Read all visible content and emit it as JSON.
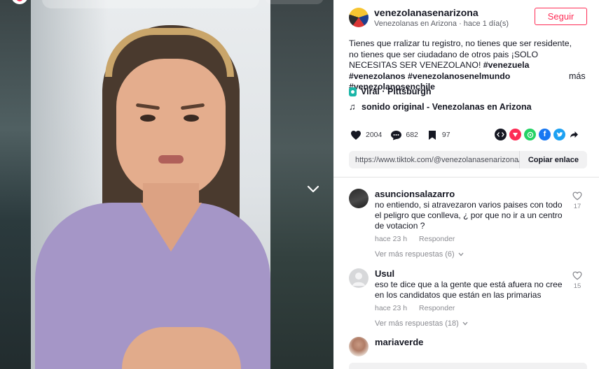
{
  "video": {
    "next_label": "next-video"
  },
  "author": {
    "username": "venezolanasenarizona",
    "meta": "Venezolanas  en  Arizona · hace 1 día(s)",
    "follow_label": "Seguir"
  },
  "description": {
    "text": "Tienes que rralizar tu registro, no tienes que ser residente, no tienes que ser ciudadano de otros pais ¡SOLO NECESITAS SER VENEZOLANO!",
    "hashtags": "#venezuela #venezolanos #venezolanosenelmundo #venezolanosenchile",
    "more_label": "más"
  },
  "anchor": {
    "label": "Viral · Pittsburgh",
    "icon": "location-pin-icon",
    "color": "#1bb6a8"
  },
  "music": {
    "label": "sonido original - Venezolanas  en  Arizona",
    "icon": "music-note-icon"
  },
  "stats": {
    "likes": "2004",
    "comments": "682",
    "saves": "97"
  },
  "share": {
    "icons": [
      "embed-icon",
      "repost-icon",
      "whatsapp-icon",
      "facebook-icon",
      "twitter-icon",
      "share-arrow-icon"
    ],
    "colors": {
      "embed": "#161823",
      "repost": "#fe2c55",
      "whatsapp": "#25d366",
      "facebook": "#1877f2",
      "twitter": "#1da1f2"
    }
  },
  "link": {
    "url": "https://www.tiktok.com/@venezolanasenarizona/...",
    "copy_label": "Copiar enlace"
  },
  "comments": [
    {
      "username": "asuncionsalazarro",
      "text": "no entiendo, si atravezaron varios paises con todo el peligro que conlleva, ¿ por que no ir a un centro de votacion ?",
      "time": "hace 23 h",
      "reply_label": "Responder",
      "likes": "17",
      "more_replies": "Ver más respuestas (6)"
    },
    {
      "username": "Usul",
      "text": "eso te dice que a la gente que está afuera no cree en los candidatos que están en las primarias",
      "time": "hace 23 h",
      "reply_label": "Responder",
      "likes": "15",
      "more_replies": "Ver más respuestas (18)"
    },
    {
      "username": "mariaverde"
    }
  ],
  "colors": {
    "accent": "#fe2c55",
    "text": "#161823",
    "secondary_text": "#8a8b91"
  }
}
